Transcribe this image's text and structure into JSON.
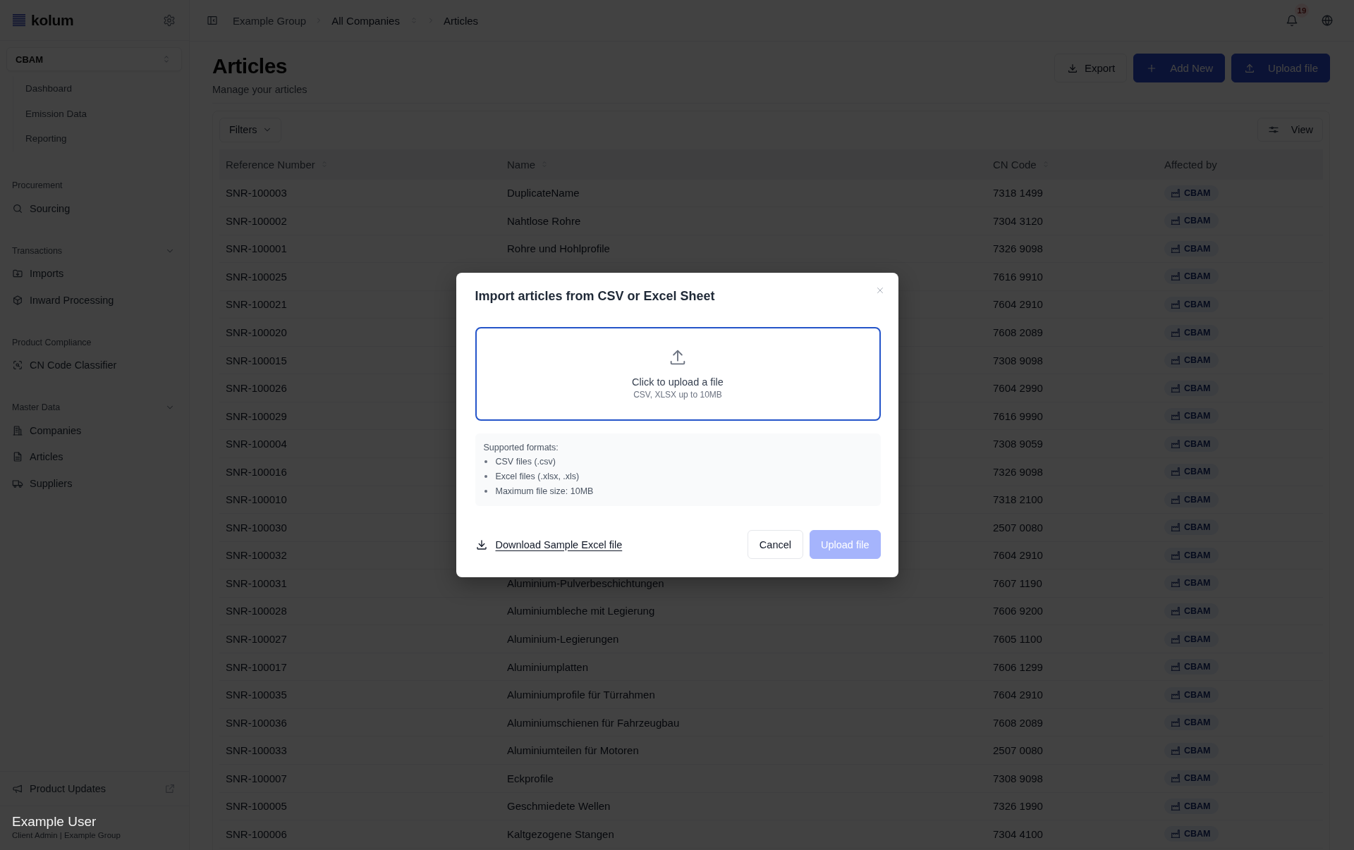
{
  "sidebar": {
    "logo": "kolum",
    "module": "CBAM",
    "module_items": [
      "Dashboard",
      "Emission Data",
      "Reporting"
    ],
    "groups": [
      {
        "label": "Procurement",
        "kind": "plain",
        "items": [
          "Sourcing"
        ]
      },
      {
        "label": "Transactions",
        "kind": "collapsible",
        "expanded": true,
        "items": [
          "Imports",
          "Inward Processing"
        ]
      },
      {
        "label": "Product Compliance",
        "kind": "plain",
        "items": [
          "CN Code Classifier"
        ]
      },
      {
        "label": "Master Data",
        "kind": "collapsible",
        "expanded": true,
        "items": [
          "Companies",
          "Articles",
          "Suppliers"
        ]
      }
    ],
    "footer_link": "Product Updates",
    "user": {
      "name": "Example User",
      "role": "Client Admin | Example Group"
    }
  },
  "header": {
    "breadcrumbs": [
      {
        "label": "Example Group",
        "kind": "parent"
      },
      {
        "label": "All Companies",
        "kind": "switcher"
      },
      {
        "label": "Articles",
        "kind": "current"
      }
    ],
    "notification_count": "19"
  },
  "page": {
    "title": "Articles",
    "subtitle": "Manage your articles",
    "actions": [
      {
        "label": "Export",
        "kind": "export"
      },
      {
        "label": "Add New",
        "kind": "add"
      },
      {
        "label": "Upload file",
        "kind": "upload"
      }
    ]
  },
  "toolbar": {
    "filters": "Filters",
    "view": "View"
  },
  "table": {
    "columns": [
      {
        "label": "Reference Number",
        "sortable": true
      },
      {
        "label": "Name",
        "sortable": true
      },
      {
        "label": "CN Code",
        "sortable": true
      },
      {
        "label": "Affected by",
        "sortable": false
      }
    ],
    "rows": [
      {
        "reference": "SNR-100003",
        "name": "DuplicateName",
        "cn_code": "7318 1499",
        "affected_by": "CBAM"
      },
      {
        "reference": "SNR-100002",
        "name": "Nahtlose Rohre",
        "cn_code": "7304 3120",
        "affected_by": "CBAM"
      },
      {
        "reference": "SNR-100001",
        "name": "Rohre und Hohlprofile",
        "cn_code": "7326 9098",
        "affected_by": "CBAM"
      },
      {
        "reference": "SNR-100025",
        "cn_code": "7616 9910",
        "affected_by": "CBAM"
      },
      {
        "reference": "SNR-100021",
        "cn_code": "7604 2910",
        "affected_by": "CBAM"
      },
      {
        "reference": "SNR-100020",
        "cn_code": "7608 2089",
        "affected_by": "CBAM"
      },
      {
        "reference": "SNR-100015",
        "cn_code": "7308 9098",
        "affected_by": "CBAM"
      },
      {
        "reference": "SNR-100026",
        "cn_code": "7604 2990",
        "affected_by": "CBAM"
      },
      {
        "reference": "SNR-100029",
        "cn_code": "7616 9990",
        "affected_by": "CBAM"
      },
      {
        "reference": "SNR-100004",
        "cn_code": "7308 9059",
        "affected_by": "CBAM"
      },
      {
        "reference": "SNR-100016",
        "cn_code": "7326 9098",
        "affected_by": "CBAM"
      },
      {
        "reference": "SNR-100010",
        "cn_code": "7318 2100",
        "affected_by": "CBAM"
      },
      {
        "reference": "SNR-100030",
        "cn_code": "2507 0080",
        "affected_by": "CBAM"
      },
      {
        "reference": "SNR-100032",
        "cn_code": "7604 2910",
        "affected_by": "CBAM"
      },
      {
        "reference": "SNR-100031",
        "name": "Aluminium-Pulverbeschichtungen",
        "cn_code": "7607 1190",
        "affected_by": "CBAM"
      },
      {
        "reference": "SNR-100028",
        "name": "Aluminiumbleche mit Legierung",
        "cn_code": "7606 9200",
        "affected_by": "CBAM"
      },
      {
        "reference": "SNR-100027",
        "name": "Aluminium-Legierungen",
        "cn_code": "7605 1100",
        "affected_by": "CBAM"
      },
      {
        "reference": "SNR-100017",
        "name": "Aluminiumplatten",
        "cn_code": "7606 1299",
        "affected_by": "CBAM"
      },
      {
        "reference": "SNR-100035",
        "name": "Aluminiumprofile für Türrahmen",
        "cn_code": "7604 2910",
        "affected_by": "CBAM"
      },
      {
        "reference": "SNR-100036",
        "name": "Aluminiumschienen für Fahrzeugbau",
        "cn_code": "7608 2089",
        "affected_by": "CBAM"
      },
      {
        "reference": "SNR-100033",
        "name": "Aluminiumteilen für Motoren",
        "cn_code": "2507 0080",
        "affected_by": "CBAM"
      },
      {
        "reference": "SNR-100007",
        "name": "Eckprofile",
        "cn_code": "7308 9098",
        "affected_by": "CBAM"
      },
      {
        "reference": "SNR-100005",
        "name": "Geschmiedete Wellen",
        "cn_code": "7326 1990",
        "affected_by": "CBAM"
      },
      {
        "reference": "SNR-100006",
        "name": "Kaltgezogene Stangen",
        "cn_code": "7304 4100",
        "affected_by": "CBAM"
      }
    ]
  },
  "modal": {
    "title": "Import articles from CSV or Excel Sheet",
    "dropzone": {
      "label": "Click to upload a file",
      "hint": "CSV, XLSX up to 10MB"
    },
    "formats": {
      "heading": "Supported formats:",
      "items": [
        "CSV files (.csv)",
        "Excel files (.xlsx, .xls)",
        "Maximum file size: 10MB"
      ]
    },
    "download_link": "Download Sample Excel file",
    "buttons": [
      {
        "label": "Cancel",
        "kind": "cancel",
        "disabled": false
      },
      {
        "label": "Upload file",
        "kind": "submit",
        "disabled": true
      }
    ]
  }
}
